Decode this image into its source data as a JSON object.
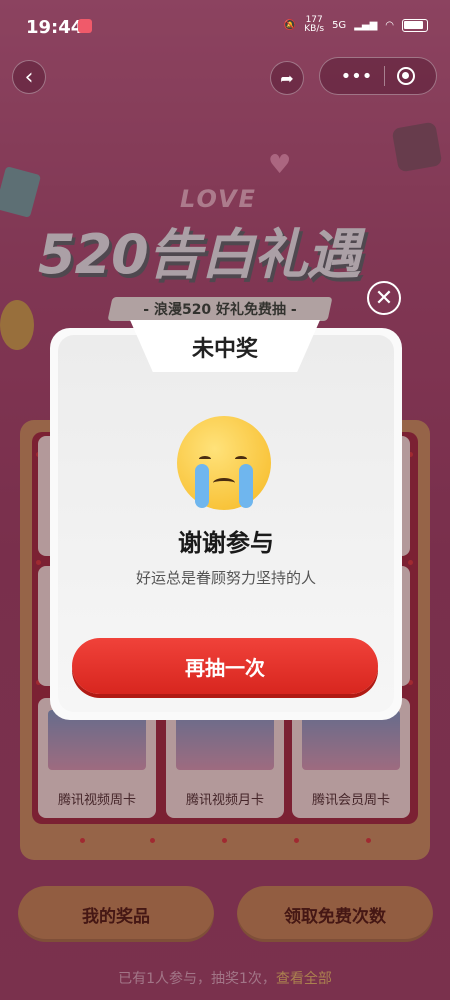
{
  "status_bar": {
    "time": "19:44",
    "net_speed": "177\nKB/s",
    "signal": "5G"
  },
  "banner": {
    "love": "LOVE",
    "title": "520告白礼遇",
    "subtitle": "- 浪漫520  好礼免费抽 -"
  },
  "prizes": [
    {
      "name": "腾讯视频周卡"
    },
    {
      "name": "腾讯视频月卡"
    },
    {
      "name": "腾讯会员周卡"
    }
  ],
  "buttons": {
    "my_prize": "我的奖品",
    "free_times": "领取免费次数"
  },
  "footer": {
    "text": "已有1人参与，抽奖1次，",
    "link": "查看全部"
  },
  "modal": {
    "title": "未中奖",
    "heading": "谢谢参与",
    "description": "好运总是眷顾努力坚持的人",
    "retry_label": "再抽一次"
  },
  "colors": {
    "accent_red": "#e8342c",
    "button_gold": "#c08a55",
    "background": "#a55070"
  },
  "icons": {
    "back": "chevron-left-icon",
    "share": "share-arrow-icon",
    "more": "more-dots-icon",
    "close_miniprogram": "target-ring-icon",
    "close_modal": "close-icon",
    "emoji": "crying-face-icon"
  }
}
